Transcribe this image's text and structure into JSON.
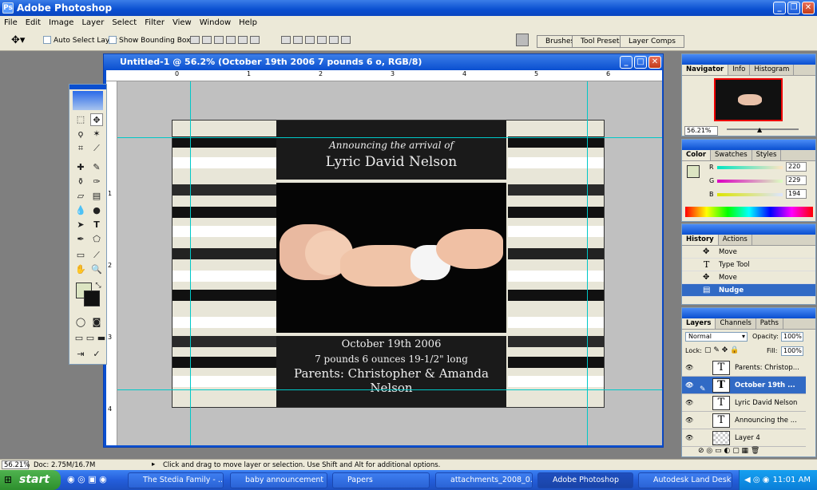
{
  "app": {
    "title": "Adobe Photoshop"
  },
  "menu": [
    "File",
    "Edit",
    "Image",
    "Layer",
    "Select",
    "Filter",
    "View",
    "Window",
    "Help"
  ],
  "options": {
    "auto_select": "Auto Select Layer",
    "show_bbox": "Show Bounding Box",
    "well_tabs": [
      "Brushes",
      "Tool Presets",
      "Layer Comps"
    ]
  },
  "document": {
    "title": "Untitled-1 @ 56.2% (October 19th 2006 7 pounds 6 o, RGB/8)",
    "ruler_top": [
      "0",
      "1",
      "2",
      "3",
      "4",
      "5",
      "6"
    ],
    "ruler_left": [
      "1",
      "2",
      "3",
      "4"
    ]
  },
  "artwork": {
    "announce": "Announcing the arrival of",
    "name": "Lyric David Nelson",
    "date": "October 19th 2006",
    "weight": "7 pounds 6 ounces  19-1/2\" long",
    "parents": "Parents: Christopher & Amanda Nelson"
  },
  "navigator": {
    "tabs": [
      "Navigator",
      "Info",
      "Histogram"
    ],
    "zoom": "56.21%"
  },
  "color": {
    "tabs": [
      "Color",
      "Swatches",
      "Styles"
    ],
    "r_label": "R",
    "g_label": "G",
    "b_label": "B",
    "r": "220",
    "g": "229",
    "b": "194",
    "fg": "#dce5c2"
  },
  "history": {
    "tabs": [
      "History",
      "Actions"
    ],
    "items": [
      "Move",
      "Type Tool",
      "Move",
      "Nudge"
    ]
  },
  "layers": {
    "tabs": [
      "Layers",
      "Channels",
      "Paths"
    ],
    "blend": "Normal",
    "opacity_label": "Opacity:",
    "opacity": "100%",
    "lock_label": "Lock:",
    "fill_label": "Fill:",
    "fill": "100%",
    "items": [
      "Parents: Christop...",
      "October 19th ...",
      "Lyric David Nelson",
      "Announcing the ...",
      "Layer 4"
    ]
  },
  "status": {
    "zoom": "56.21%",
    "doc": "Doc: 2.75M/16.7M",
    "hint": "Click and drag to move layer or selection.  Use Shift and Alt for additional options."
  },
  "taskbar": {
    "start": "start",
    "tasks": [
      "The Stedia Family - ...",
      "baby announcement ...",
      "Papers",
      "attachments_2008_0...",
      "Adobe Photoshop",
      "Autodesk Land Deskt..."
    ],
    "clock": "11:01 AM"
  }
}
